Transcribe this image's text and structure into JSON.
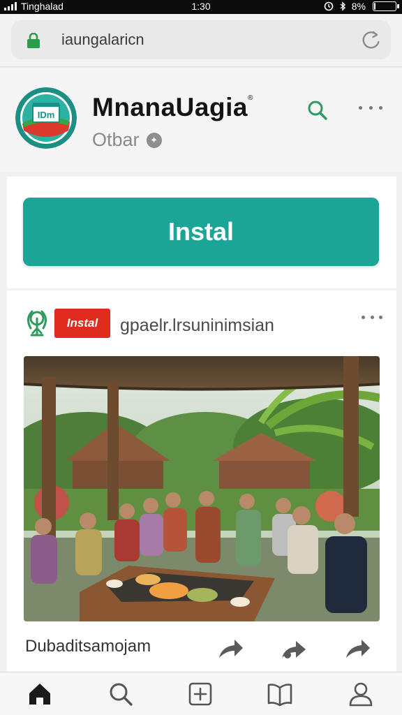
{
  "status_bar": {
    "carrier": "Tinghalad",
    "time": "1:30",
    "battery": "8%",
    "battery_level_percent": 8
  },
  "browser": {
    "url": "iaungalaricn",
    "lock_icon": "lock-icon",
    "reload_icon": "reload-icon"
  },
  "app": {
    "name": "MnanaUagia",
    "trademark": "®",
    "subtitle": "Otbar",
    "verified_icon": "verified-icon"
  },
  "install": {
    "label": "Instal"
  },
  "post": {
    "badge": "Instal",
    "handle": "gpaelr.lrsuninimsian",
    "caption": "Dubaditsamojam",
    "icon": "tree-icon"
  },
  "nav": {
    "items": [
      "home",
      "search",
      "add",
      "library",
      "profile"
    ]
  },
  "colors": {
    "accent": "#1aa597",
    "badge_red": "#e02b1f",
    "green_icon": "#2e9a5e"
  }
}
